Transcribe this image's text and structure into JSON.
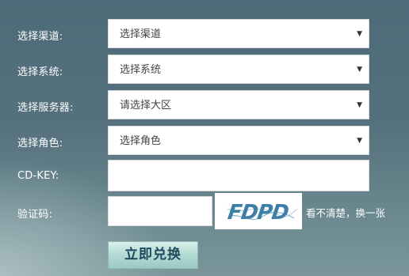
{
  "form": {
    "channel": {
      "label": "选择渠道:",
      "value": "选择渠道"
    },
    "system": {
      "label": "选择系统:",
      "value": "选择系统"
    },
    "server": {
      "label": "选择服务器:",
      "value": "请选择大区"
    },
    "role": {
      "label": "选择角色:",
      "value": "选择角色"
    },
    "cdkey": {
      "label": "CD-KEY:",
      "value": ""
    },
    "captcha": {
      "label": "验证码:",
      "value": "",
      "image_text": "FDPD",
      "refresh_text": "看不清楚，换一张"
    },
    "submit_label": "立即兑换"
  },
  "icons": {
    "dropdown": "chevron-down-icon"
  },
  "colors": {
    "background": "#55717d",
    "button_text": "#1e4a5c",
    "captcha_text": "#3e7fa8"
  }
}
